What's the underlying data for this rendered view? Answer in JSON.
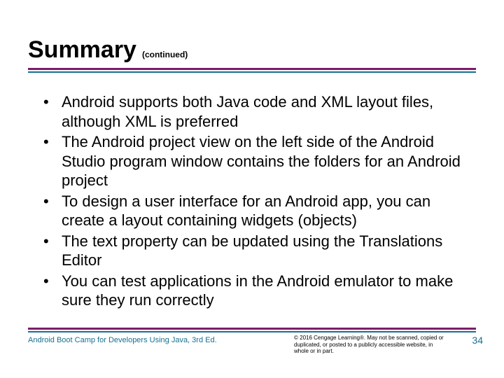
{
  "heading": {
    "title": "Summary",
    "subtitle": "(continued)"
  },
  "bullets": [
    "Android supports both Java code and XML layout files, although XML is preferred",
    "The Android project view on the left side of the Android Studio program window contains the folders for an Android project",
    "To design a user interface for an Android app, you can create a layout containing widgets (objects)",
    "The text property can be updated using the Translations Editor",
    "You can test applications in the Android emulator to make sure they run correctly"
  ],
  "footer": {
    "book": "Android Boot Camp for Developers Using Java, 3rd Ed.",
    "copyright": "© 2016 Cengage Learning®. May not be scanned, copied or duplicated, or posted to a publicly accessible website, in whole or in part.",
    "page": "34"
  }
}
